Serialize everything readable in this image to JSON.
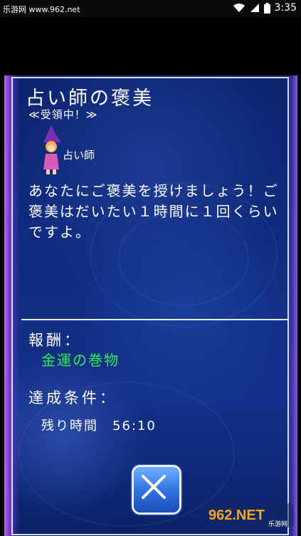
{
  "status_bar": {
    "site": "乐游网 www.962.net",
    "time": "3:35"
  },
  "dialog": {
    "title": "占い師の褒美",
    "status_label": "≪受領中！≫",
    "npc_name": "占い師",
    "message": "あなたにご褒美を授けましょう！ご褒美はだいたい１時間に１回くらいですよ。",
    "reward_label": "報酬：",
    "reward_value": "金運の巻物",
    "condition_label": "達成条件：",
    "condition_value": "残り時間　56:10",
    "close_icon": "close-x-icon"
  },
  "watermark": {
    "main": "962.NET",
    "sub": "乐游网"
  },
  "colors": {
    "reward": "#34ee4a",
    "panel": "#102c80",
    "button": "#2d6fe0"
  }
}
